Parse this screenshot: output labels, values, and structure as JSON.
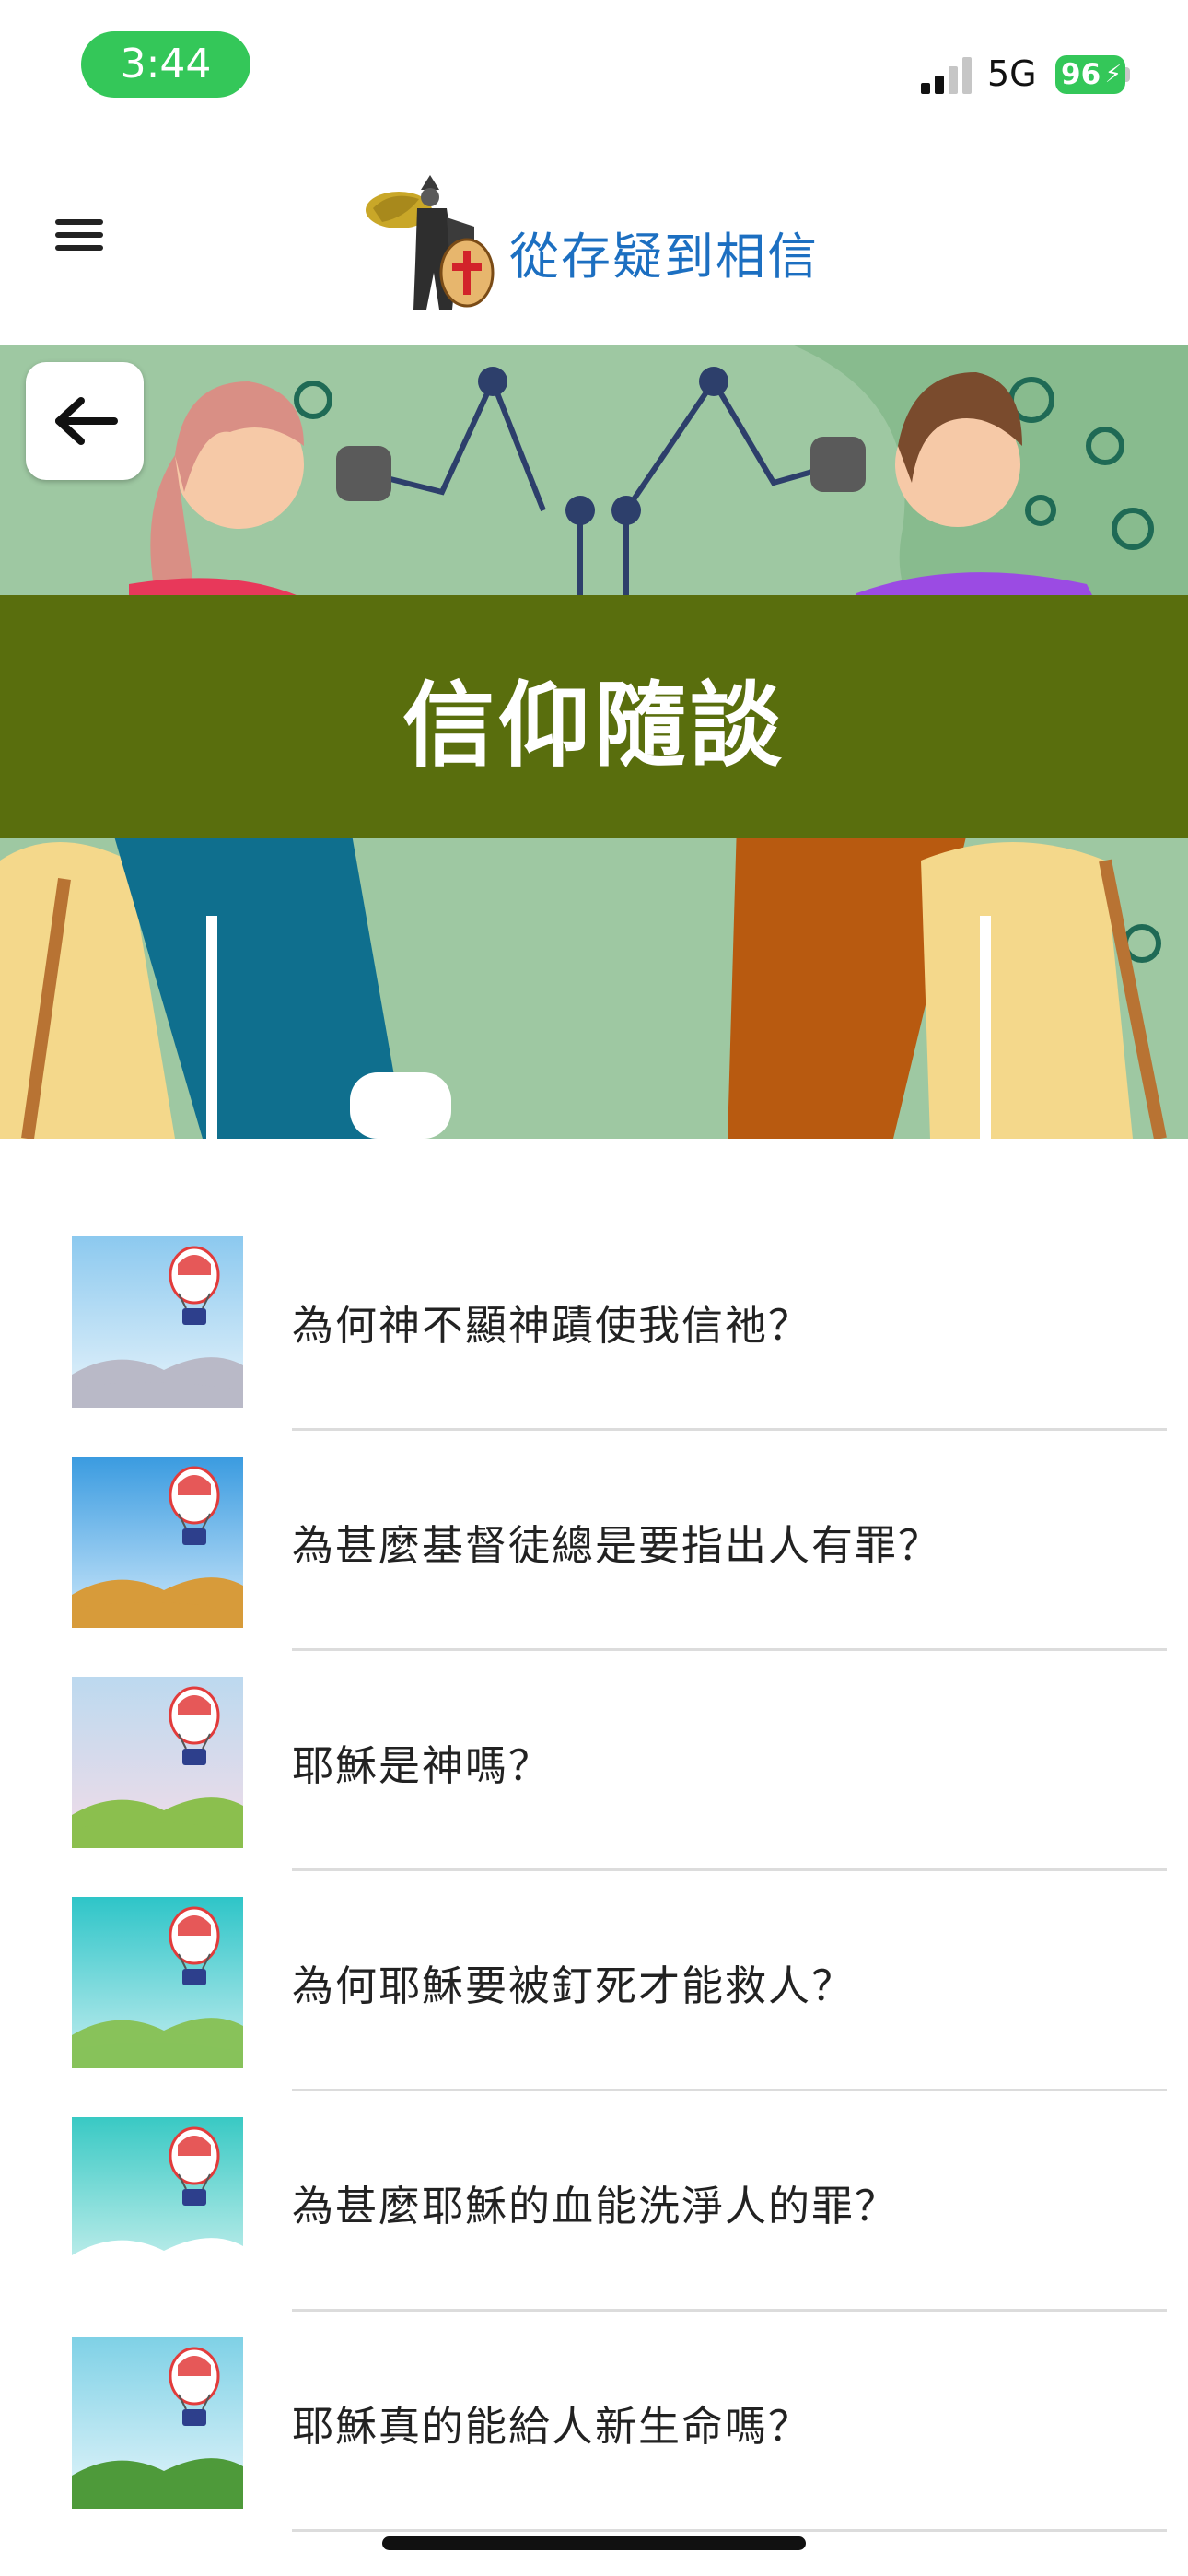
{
  "status_bar": {
    "time": "3:44",
    "network": "5G",
    "battery": "96"
  },
  "header": {
    "site_title": "從存疑到相信",
    "menu_icon": "hamburger-menu-icon",
    "logo_icon": "knight-logo-icon"
  },
  "hero": {
    "title": "信仰隨談",
    "back_icon": "arrow-left-icon",
    "illustration": "podcast-two-hosts-illustration"
  },
  "articles": [
    {
      "title": "為何神不顯神蹟使我信祂？",
      "thumb_scene": "city"
    },
    {
      "title": "為甚麼基督徒總是要指出人有罪？",
      "thumb_scene": "farm"
    },
    {
      "title": "耶穌是神嗎？",
      "thumb_scene": "hills"
    },
    {
      "title": "為何耶穌要被釘死才能救人？",
      "thumb_scene": "meadow"
    },
    {
      "title": "為甚麼耶穌的血能洗淨人的罪？",
      "thumb_scene": "snow-town"
    },
    {
      "title": "耶穌真的能給人新生命嗎？",
      "thumb_scene": "mountains"
    }
  ]
}
